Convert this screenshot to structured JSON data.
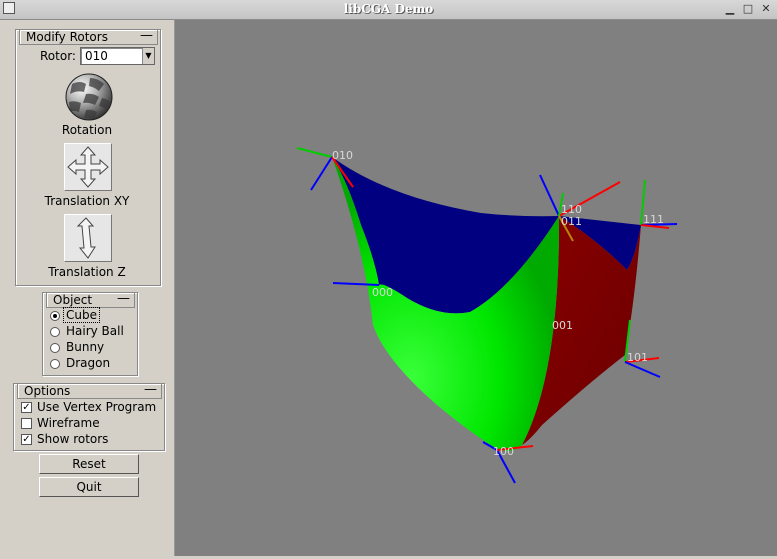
{
  "window": {
    "title": "libCGA Demo"
  },
  "modify_rotors": {
    "title": "Modify Rotors",
    "collapse": "—",
    "rotor_label": "Rotor:",
    "rotor_value": "010",
    "rotation_label": "Rotation",
    "translation_xy_label": "Translation XY",
    "translation_z_label": "Translation Z"
  },
  "object": {
    "title": "Object",
    "collapse": "—",
    "options": [
      {
        "label": "Cube",
        "selected": true
      },
      {
        "label": "Hairy Ball",
        "selected": false
      },
      {
        "label": "Bunny",
        "selected": false
      },
      {
        "label": "Dragon",
        "selected": false
      }
    ]
  },
  "options": {
    "title": "Options",
    "collapse": "—",
    "items": [
      {
        "label": "Use Vertex Program",
        "checked": true
      },
      {
        "label": "Wireframe",
        "checked": false
      },
      {
        "label": "Show rotors",
        "checked": true
      }
    ]
  },
  "buttons": {
    "reset": "Reset",
    "quit": "Quit"
  },
  "viewport": {
    "background": "#808080",
    "face_colors": {
      "top": "#000080",
      "left": "#00ff00",
      "right": "#800000"
    },
    "vertex_labels": [
      "010",
      "110",
      "011",
      "111",
      "000",
      "001",
      "101",
      "100"
    ]
  }
}
